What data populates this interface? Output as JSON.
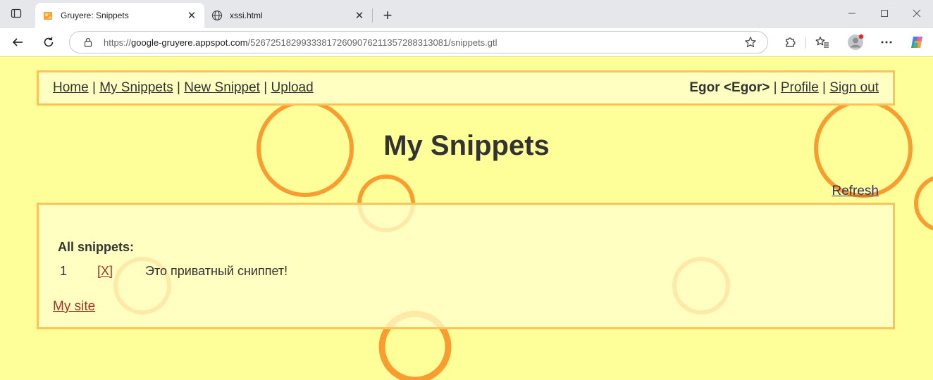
{
  "browser": {
    "tabs": [
      {
        "title": "Gruyere: Snippets",
        "active": true,
        "icon": "gruyere-favicon"
      },
      {
        "title": "xssi.html",
        "active": false,
        "icon": "globe-icon"
      }
    ],
    "address_bar": {
      "url_scheme": "https://",
      "url_host": "google-gruyere.appspot.com",
      "url_path": "/526725182993338172609076211357288313081/snippets.gtl"
    }
  },
  "nav": {
    "home": "Home",
    "sep1": " | ",
    "my_snippets": "My Snippets",
    "sep2": " | ",
    "new_snippet": "New Snippet",
    "sep3": " | ",
    "upload": "Upload",
    "user": "Egor <Egor>",
    "sep4": " | ",
    "profile": "Profile",
    "sep5": " | ",
    "sign_out": "Sign out"
  },
  "page": {
    "heading": "My Snippets",
    "refresh": "Refresh",
    "all_snippets_label": "All snippets:",
    "snippets": [
      {
        "index": "1",
        "delete_label": "[X]",
        "text": "Это приватный сниппет!"
      }
    ],
    "my_site_link": "My site"
  },
  "colors": {
    "page_background": "#ffff99",
    "panel_background": "#ffffc2",
    "panel_border": "#fbc35c",
    "bubble": "#f99d31",
    "link_red": "#a03328"
  }
}
